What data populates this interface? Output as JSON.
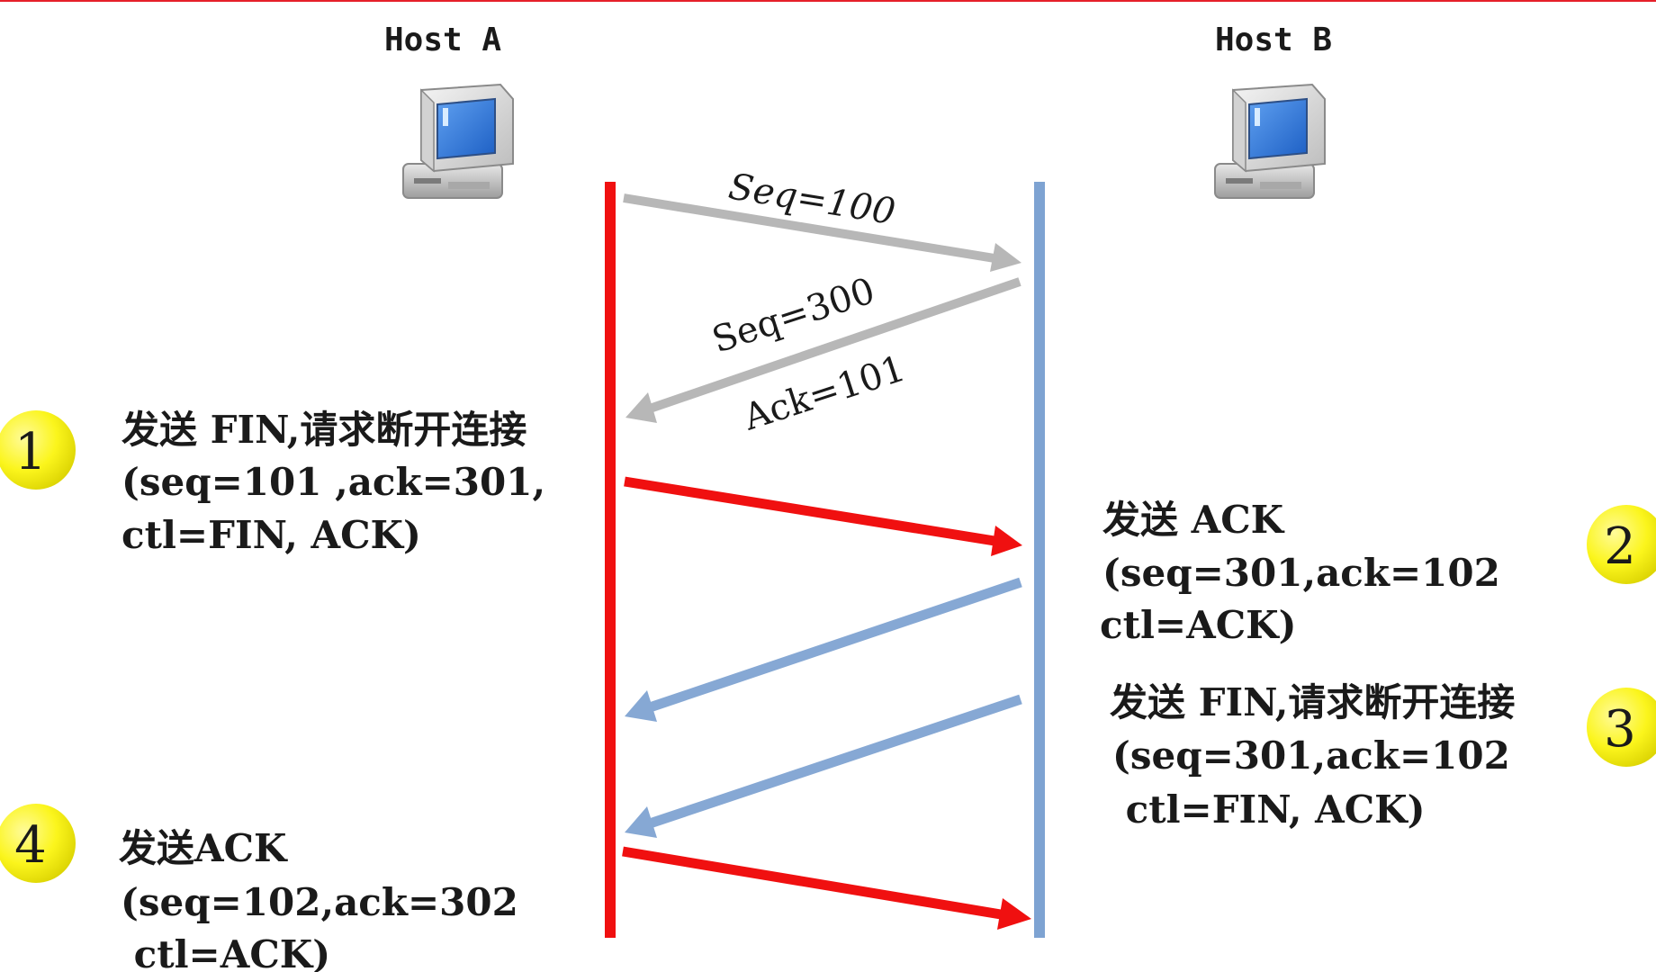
{
  "hosts": {
    "a": {
      "label": "Host A"
    },
    "b": {
      "label": "Host B"
    }
  },
  "data_exchange": {
    "a_to_b": {
      "label": "Seq=100"
    },
    "b_to_a": {
      "seq_label": "Seq=300",
      "ack_label": "Ack=101"
    }
  },
  "steps": [
    {
      "number": "1",
      "lines": [
        "发送 FIN,请求断开连接",
        "(seq=101 ,ack=301,",
        "ctl=FIN, ACK)"
      ]
    },
    {
      "number": "2",
      "lines": [
        "发送 ACK",
        "(seq=301,ack=102",
        "ctl=ACK)"
      ]
    },
    {
      "number": "3",
      "lines": [
        "发送 FIN,请求断开连接",
        "(seq=301,ack=102",
        " ctl=FIN, ACK)"
      ]
    },
    {
      "number": "4",
      "lines": [
        "发送ACK",
        "(seq=102,ack=302",
        " ctl=ACK)"
      ]
    }
  ],
  "colors": {
    "host_a_line": "#f01010",
    "host_b_line": "#7ea3d2",
    "gray_arrow": "#b7b7b7",
    "red_arrow": "#f01010",
    "blue_arrow": "#86a8d4",
    "badge": "#fbf51c",
    "top_border": "#e6202a"
  },
  "icons": {
    "host_a": "desktop-computer-icon",
    "host_b": "desktop-computer-icon"
  }
}
